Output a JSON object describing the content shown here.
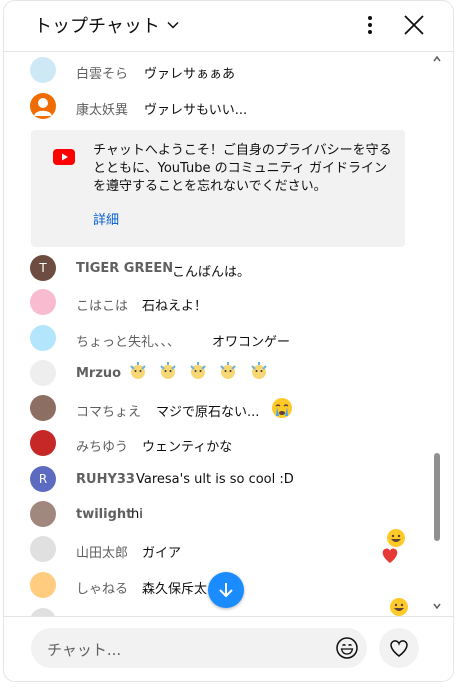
{
  "header": {
    "title": "トップチャット",
    "dropdown_icon": "chevron-down-icon",
    "more_icon": "more-vert-icon",
    "close_icon": "close-icon"
  },
  "messages": [
    {
      "author": "白雲そら",
      "text": "ヴァレサぁぁあ",
      "avatar_color": "#cfe8f5"
    },
    {
      "author": "康太妖異",
      "text": "ヴァレサもいい...",
      "avatar_color": "#ef6c00"
    },
    {
      "author": "TIGER GREEN",
      "text": "こんばんは。",
      "avatar_letter": "T",
      "avatar_color": "#6d4c41"
    },
    {
      "author": "こはこは",
      "text": "石ねえよ！",
      "avatar_color": "#f8bbd0"
    },
    {
      "author": "ちょっと失礼、、、",
      "text": "オワコンゲー",
      "avatar_color": "#b3e5fc"
    },
    {
      "author": "Mrzuo",
      "text": "",
      "avatar_color": "#eeeeee",
      "emoji_count": 5
    },
    {
      "author": "コマちょえ",
      "text": "マジで原石ない...",
      "avatar_color": "#8d6e63",
      "trailing_emoji": "crying-face-icon"
    },
    {
      "author": "みちゆう",
      "text": "ウェンティかな",
      "avatar_color": "#c62828"
    },
    {
      "author": "RUHY33",
      "text": "Varesa's ult is so cool :D",
      "avatar_letter": "R",
      "avatar_color": "#5c6bc0"
    },
    {
      "author": "twilight",
      "text": "hi",
      "avatar_color": "#a1887f"
    },
    {
      "author": "山田太郎",
      "text": "ガイア",
      "avatar_color": "#e0e0e0"
    },
    {
      "author": "しゃねる",
      "text": "森久保斥太",
      "avatar_color": "#ffcc80"
    }
  ],
  "notice": {
    "text": "チャットへようこそ！ご自身のプライバシーを守るとともに、YouTube のコミュニティ ガイドラインを遵守することを忘れないでください。",
    "link": "詳細",
    "icon": "youtube-icon",
    "brand_color": "#ff0000"
  },
  "colors": {
    "link": "#065fd4",
    "jump_button": "#1a8cff",
    "input_bg": "#f2f2f2"
  },
  "input": {
    "placeholder": "チャット...",
    "emoji_icon": "emoji-icon",
    "heart_icon": "heart-icon"
  },
  "floating_reactions": [
    "grinning-face-icon",
    "red-heart-icon",
    "grinning-face-icon"
  ],
  "jump_button_icon": "arrow-down-icon"
}
